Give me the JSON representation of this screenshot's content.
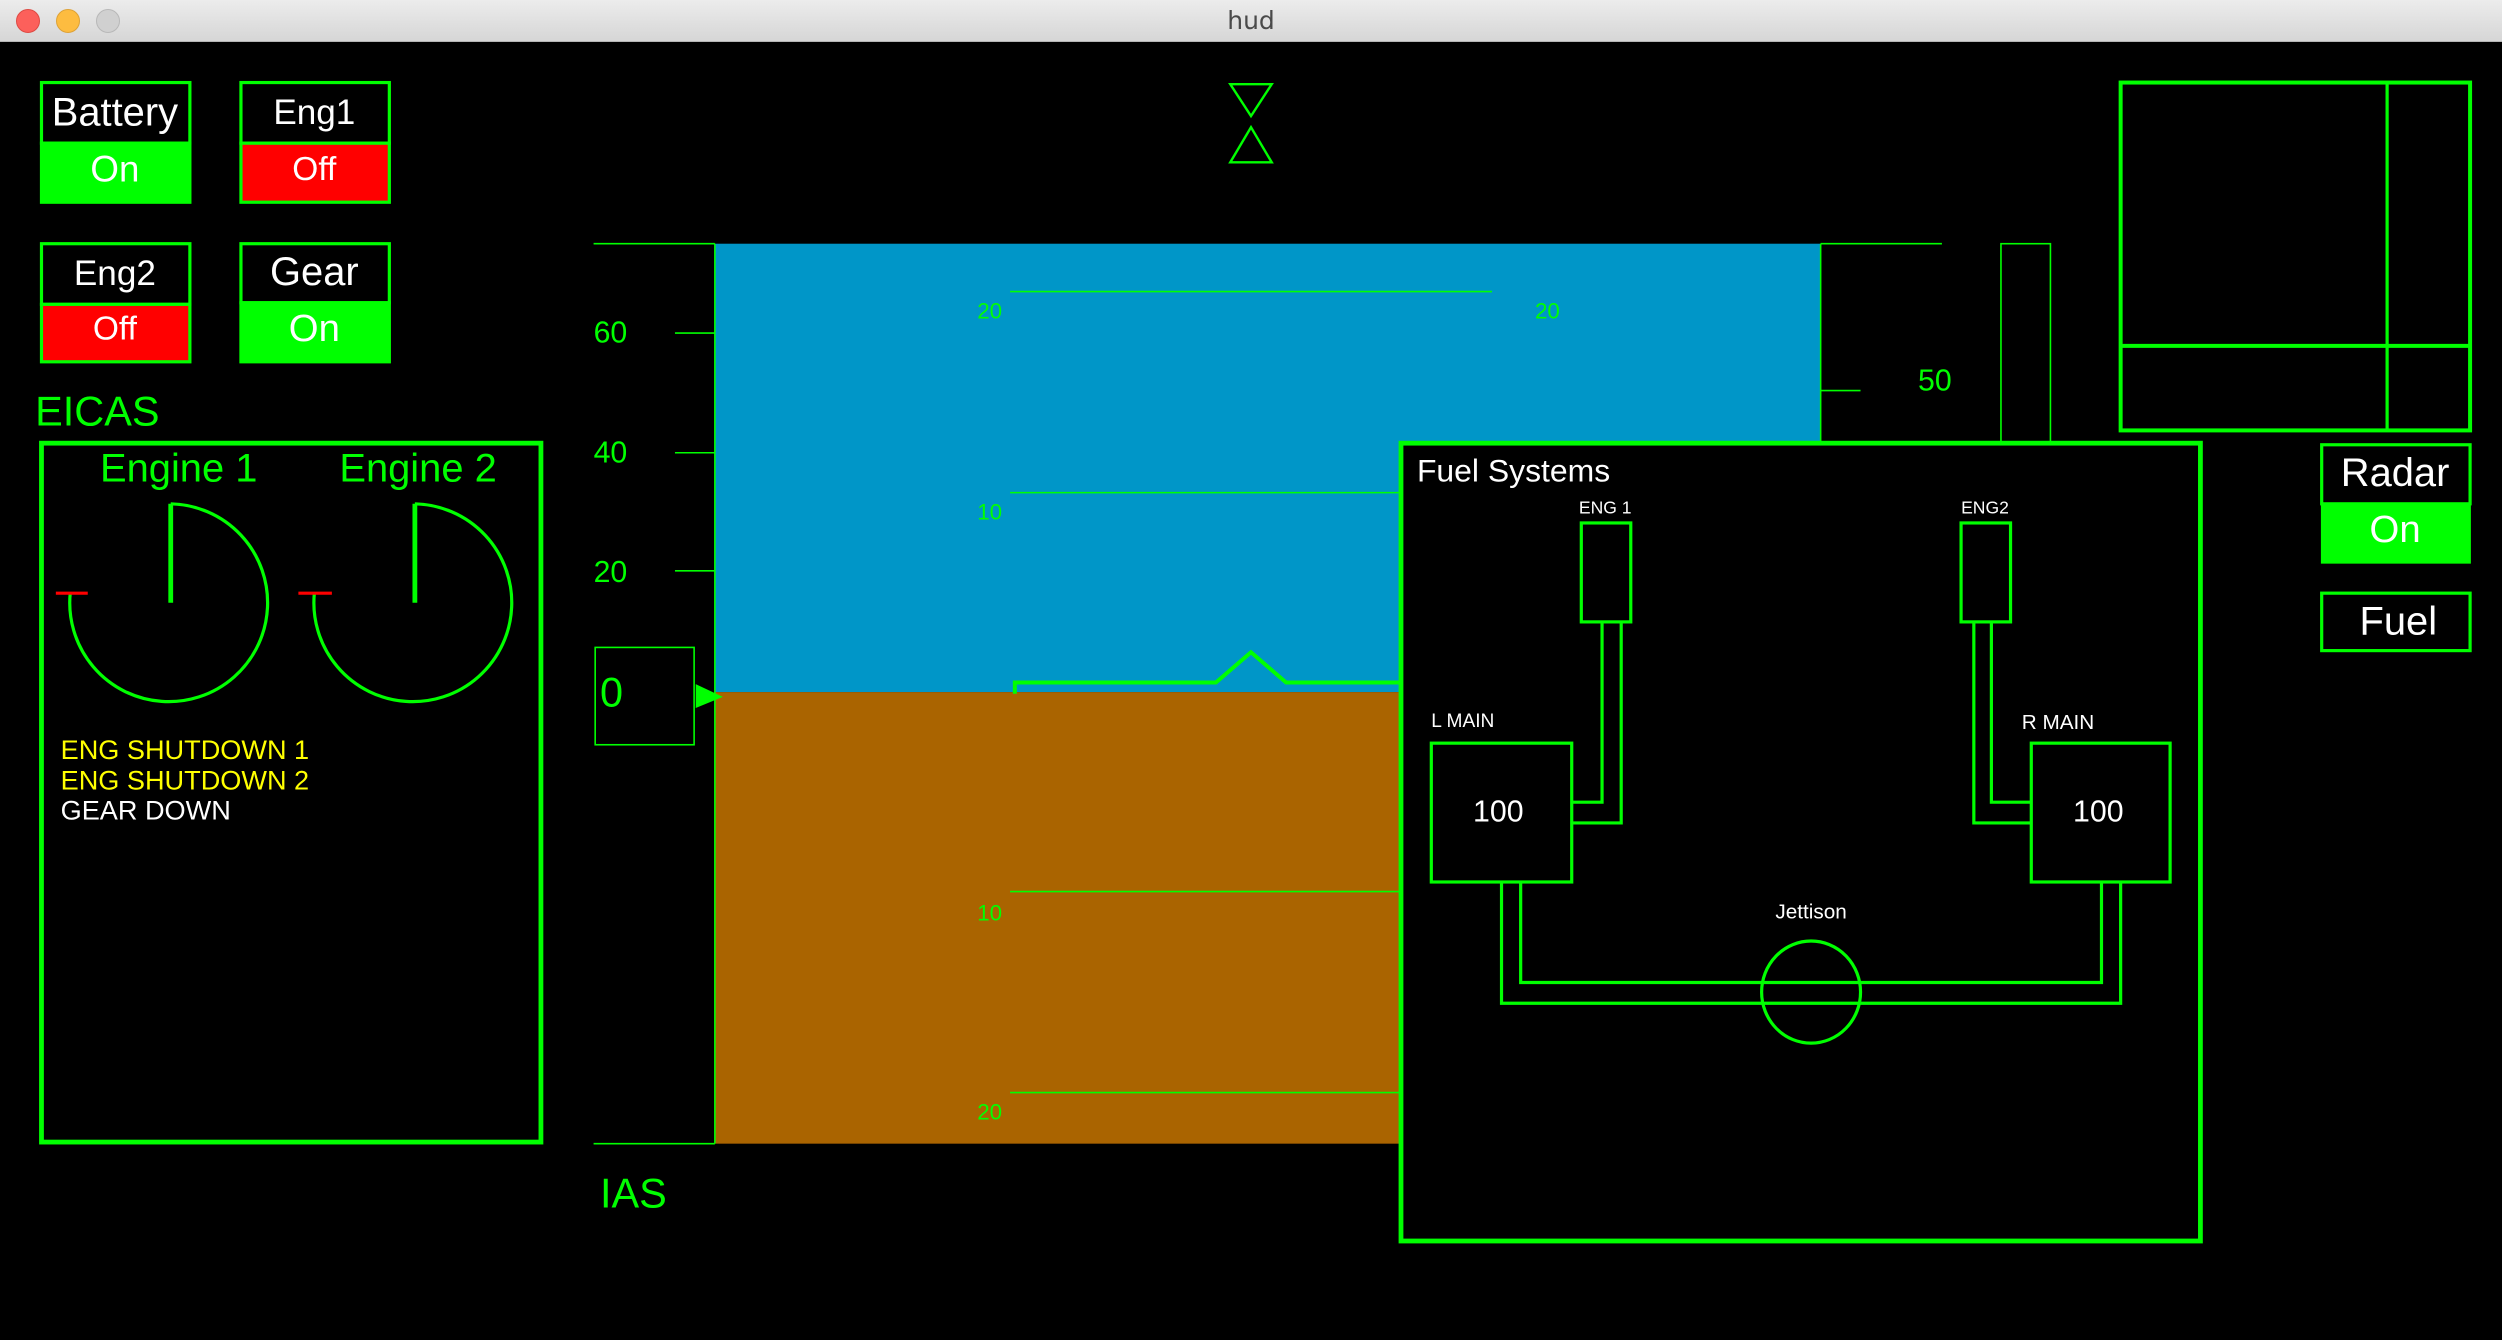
{
  "window": {
    "title": "hud"
  },
  "colors": {
    "green": "#00ff00",
    "red": "#ff0000",
    "sky": "#0096c8",
    "ground": "#aa6400",
    "yellow": "#ffff00",
    "white": "#ffffff"
  },
  "switches": [
    {
      "label": "Battery",
      "state": "On"
    },
    {
      "label": "Eng1",
      "state": "Off"
    },
    {
      "label": "Eng2",
      "state": "Off"
    },
    {
      "label": "Gear",
      "state": "On"
    },
    {
      "label": "Radar",
      "state": "On"
    }
  ],
  "fuel_button": {
    "label": "Fuel"
  },
  "eicas": {
    "title": "EICAS",
    "engines": [
      {
        "label": "Engine 1"
      },
      {
        "label": "Engine 2"
      }
    ],
    "messages": [
      {
        "text": "ENG SHUTDOWN 1",
        "level": "caution"
      },
      {
        "text": "ENG SHUTDOWN 2",
        "level": "caution"
      },
      {
        "text": "GEAR DOWN",
        "level": "advisory"
      }
    ]
  },
  "speed_tape": {
    "label": "IAS",
    "ticks": [
      "60",
      "40",
      "20"
    ],
    "current": "0"
  },
  "pitch_ladder": {
    "up": [
      "20",
      "10"
    ],
    "down": [
      "10",
      "20"
    ],
    "right_up": "20"
  },
  "altitude_tape": {
    "ticks": [
      "50"
    ]
  },
  "fuel_systems": {
    "title": "Fuel Systems",
    "eng1_label": "ENG 1",
    "eng2_label": "ENG2",
    "left_tank": {
      "label": "L MAIN",
      "value": "100"
    },
    "right_tank": {
      "label": "R MAIN",
      "value": "100"
    },
    "jettison_label": "Jettison"
  }
}
